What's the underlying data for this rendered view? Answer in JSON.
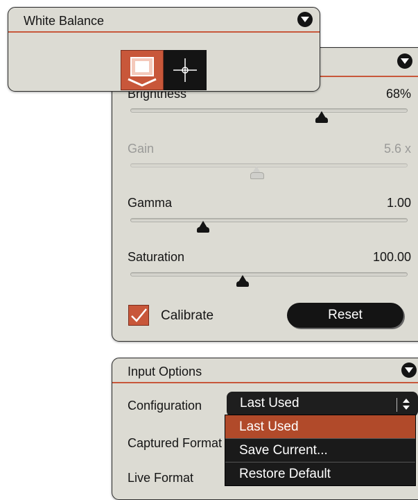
{
  "white_balance": {
    "title": "White Balance",
    "buttons": [
      {
        "name": "auto",
        "icon": "auto-white-balance-icon",
        "active": true
      },
      {
        "name": "picker",
        "icon": "crosshair-icon",
        "active": false
      }
    ]
  },
  "adjustments": {
    "brightness": {
      "label": "Brightness",
      "value": "68%",
      "level": 0.68
    },
    "gain": {
      "label": "Gain",
      "value": "5.6 x",
      "level": 0.45,
      "disabled": true
    },
    "gamma": {
      "label": "Gamma",
      "value": "1.00",
      "level": 0.25
    },
    "saturation": {
      "label": "Saturation",
      "value": "100.00",
      "level": 0.4
    },
    "calibrate": {
      "label": "Calibrate",
      "checked": true
    },
    "reset_label": "Reset"
  },
  "input_options": {
    "title": "Input Options",
    "configuration": {
      "label": "Configuration",
      "selected": "Last Used"
    },
    "captured_format": {
      "label": "Captured Format"
    },
    "live_format": {
      "label": "Live Format"
    },
    "dropdown_options": [
      "Last Used",
      "Save Current...",
      "Restore Default"
    ]
  },
  "colors": {
    "accent": "#c8573a",
    "panel": "#dcdbd3",
    "dark": "#141414"
  }
}
